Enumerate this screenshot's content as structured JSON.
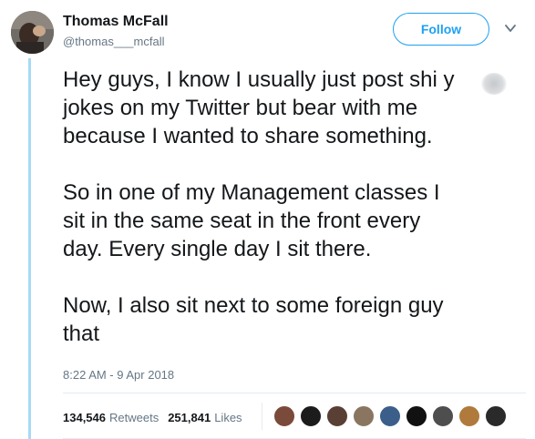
{
  "author": {
    "name": "Thomas McFall",
    "handle": "@thomas___mcfall"
  },
  "follow_label": "Follow",
  "tweet_paragraphs": [
    "Hey guys, I know I usually just post shi   y\njokes on my Twitter but bear with me\nbecause I wanted to share something.",
    "So in one of my Management classes I\nsit in the same seat in the front every\nday. Every single day I sit there.",
    "Now, I also sit next to some foreign guy\nthat"
  ],
  "timestamp": "8:22 AM - 9 Apr 2018",
  "stats": {
    "retweets_count": "134,546",
    "retweets_label": "Retweets",
    "likes_count": "251,841",
    "likes_label": "Likes"
  },
  "colors": {
    "accent": "#1da1f2",
    "thread_line": "#a8d9f5",
    "muted_text": "#657786",
    "primary_text": "#14171a"
  },
  "liker_avatars": [
    {
      "color": "#7a4a3a"
    },
    {
      "color": "#1c1c1c"
    },
    {
      "color": "#5a3f35"
    },
    {
      "color": "#8a7660"
    },
    {
      "color": "#3b5f8a"
    },
    {
      "color": "#111111"
    },
    {
      "color": "#4e4e4e"
    },
    {
      "color": "#b07a3c"
    },
    {
      "color": "#2a2a2a"
    }
  ]
}
